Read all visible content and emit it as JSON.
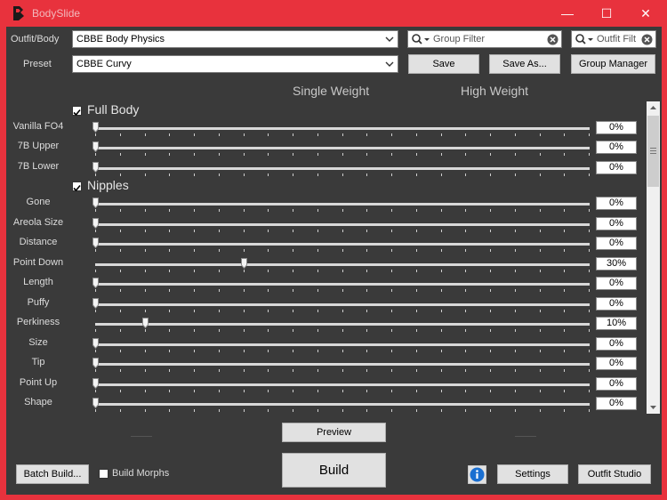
{
  "window": {
    "title": "BodySlide",
    "minimize": "—",
    "maximize": "☐",
    "close": "✕"
  },
  "top": {
    "outfit_label": "Outfit/Body",
    "outfit_value": "CBBE Body Physics",
    "preset_label": "Preset",
    "preset_value": "CBBE Curvy",
    "group_filter_placeholder": "Group Filter",
    "outfit_filter_placeholder": "Outfit Filter",
    "save": "Save",
    "save_as": "Save As...",
    "group_manager": "Group Manager"
  },
  "headers": {
    "single": "Single Weight",
    "high": "High Weight"
  },
  "groups": [
    {
      "name": "Full Body",
      "checked": true,
      "sliders": [
        {
          "label": "Vanilla FO4",
          "value": 0,
          "display": "0%"
        },
        {
          "label": "7B Upper",
          "value": 0,
          "display": "0%"
        },
        {
          "label": "7B Lower",
          "value": 0,
          "display": "0%"
        }
      ]
    },
    {
      "name": "Nipples",
      "checked": true,
      "sliders": [
        {
          "label": "Gone",
          "value": 0,
          "display": "0%"
        },
        {
          "label": "Areola Size",
          "value": 0,
          "display": "0%"
        },
        {
          "label": "Distance",
          "value": 0,
          "display": "0%"
        },
        {
          "label": "Point Down",
          "value": 30,
          "display": "30%"
        },
        {
          "label": "Length",
          "value": 0,
          "display": "0%"
        },
        {
          "label": "Puffy",
          "value": 0,
          "display": "0%"
        },
        {
          "label": "Perkiness",
          "value": 10,
          "display": "10%"
        },
        {
          "label": "Size",
          "value": 0,
          "display": "0%"
        },
        {
          "label": "Tip",
          "value": 0,
          "display": "0%"
        },
        {
          "label": "Point Up",
          "value": 0,
          "display": "0%"
        },
        {
          "label": "Shape",
          "value": 0,
          "display": "0%"
        }
      ]
    }
  ],
  "bottom": {
    "preview": "Preview",
    "build": "Build",
    "batch_build": "Batch Build...",
    "build_morphs": "Build Morphs",
    "settings": "Settings",
    "outfit_studio": "Outfit Studio"
  },
  "colors": {
    "accent": "#e8323d",
    "panel": "#3a3a3a"
  }
}
